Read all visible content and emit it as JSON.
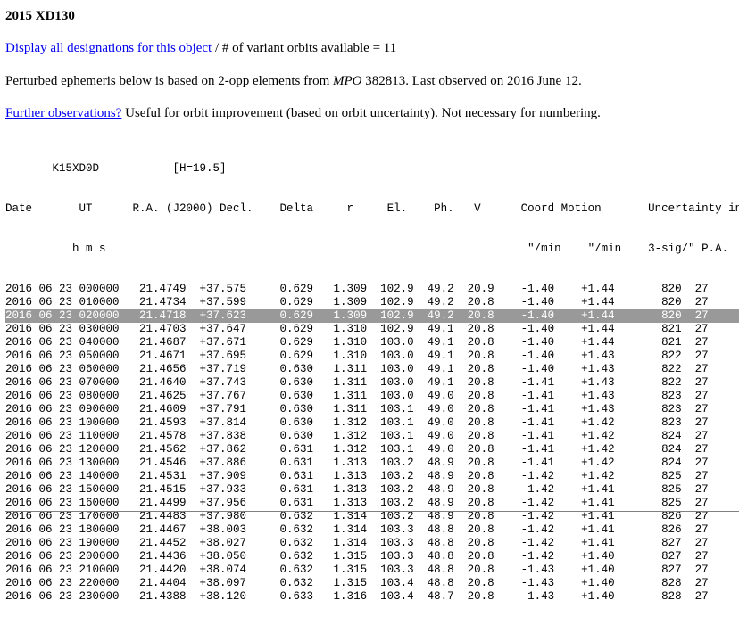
{
  "title": "2015 XD130",
  "designations": {
    "link_text": "Display all designations for this object",
    "suffix": " / # of variant orbits available = 11"
  },
  "ephemeris_note": {
    "prefix": "Perturbed ephemeris below is based on 2-opp elements from ",
    "mpo": "MPO",
    "suffix": " 382813. Last observed on 2016 June 12."
  },
  "further": {
    "link_text": "Further observations?",
    "suffix": " Useful for orbit improvement (based on orbit uncertainty). Not necessary for numbering."
  },
  "table": {
    "header_lines": [
      "       K15XD0D           [H=19.5]",
      "Date       UT      R.A. (J2000) Decl.    Delta     r     El.    Ph.   V      Coord Motion       Uncertainty info",
      "          h m s                                                               \"/min    \"/min    3-sig/\" P.A."
    ],
    "highlight_index": 2,
    "rows": [
      "2016 06 23 000000   21.4749  +37.575     0.629   1.309  102.9  49.2  20.9    -1.40    +1.44       820  27",
      "2016 06 23 010000   21.4734  +37.599     0.629   1.309  102.9  49.2  20.8    -1.40    +1.44       820  27",
      "2016 06 23 020000   21.4718  +37.623     0.629   1.309  102.9  49.2  20.8    -1.40    +1.44       820  27",
      "2016 06 23 030000   21.4703  +37.647     0.629   1.310  102.9  49.1  20.8    -1.40    +1.44       821  27",
      "2016 06 23 040000   21.4687  +37.671     0.629   1.310  103.0  49.1  20.8    -1.40    +1.44       821  27",
      "2016 06 23 050000   21.4671  +37.695     0.629   1.310  103.0  49.1  20.8    -1.40    +1.43       822  27",
      "2016 06 23 060000   21.4656  +37.719     0.630   1.311  103.0  49.1  20.8    -1.40    +1.43       822  27",
      "2016 06 23 070000   21.4640  +37.743     0.630   1.311  103.0  49.1  20.8    -1.41    +1.43       822  27",
      "2016 06 23 080000   21.4625  +37.767     0.630   1.311  103.0  49.0  20.8    -1.41    +1.43       823  27",
      "2016 06 23 090000   21.4609  +37.791     0.630   1.311  103.1  49.0  20.8    -1.41    +1.43       823  27",
      "2016 06 23 100000   21.4593  +37.814     0.630   1.312  103.1  49.0  20.8    -1.41    +1.42       823  27",
      "2016 06 23 110000   21.4578  +37.838     0.630   1.312  103.1  49.0  20.8    -1.41    +1.42       824  27",
      "2016 06 23 120000   21.4562  +37.862     0.631   1.312  103.1  49.0  20.8    -1.41    +1.42       824  27",
      "2016 06 23 130000   21.4546  +37.886     0.631   1.313  103.2  48.9  20.8    -1.41    +1.42       824  27",
      "2016 06 23 140000   21.4531  +37.909     0.631   1.313  103.2  48.9  20.8    -1.42    +1.42       825  27",
      "2016 06 23 150000   21.4515  +37.933     0.631   1.313  103.2  48.9  20.8    -1.42    +1.41       825  27",
      "2016 06 23 160000   21.4499  +37.956     0.631   1.313  103.2  48.9  20.8    -1.42    +1.41       825  27",
      "2016 06 23 170000   21.4483  +37.980     0.632   1.314  103.2  48.9  20.8    -1.42    +1.41       826  27",
      "2016 06 23 180000   21.4467  +38.003     0.632   1.314  103.3  48.8  20.8    -1.42    +1.41       826  27",
      "2016 06 23 190000   21.4452  +38.027     0.632   1.314  103.3  48.8  20.8    -1.42    +1.41       827  27",
      "2016 06 23 200000   21.4436  +38.050     0.632   1.315  103.3  48.8  20.8    -1.42    +1.40       827  27",
      "2016 06 23 210000   21.4420  +38.074     0.632   1.315  103.3  48.8  20.8    -1.43    +1.40       827  27",
      "2016 06 23 220000   21.4404  +38.097     0.632   1.315  103.4  48.8  20.8    -1.43    +1.40       828  27",
      "2016 06 23 230000   21.4388  +38.120     0.633   1.316  103.4  48.7  20.8    -1.43    +1.40       828  27"
    ]
  }
}
